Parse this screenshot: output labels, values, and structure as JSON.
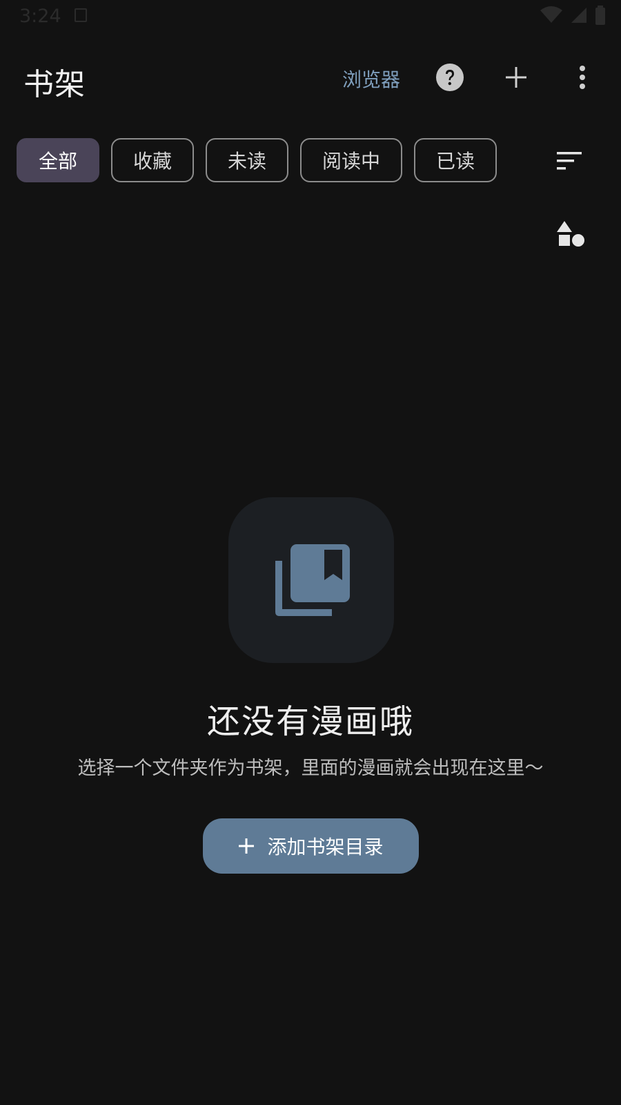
{
  "status_bar": {
    "time": "3:24"
  },
  "app_bar": {
    "title": "书架",
    "browser_label": "浏览器"
  },
  "filters": {
    "chips": [
      {
        "label": "全部",
        "selected": true
      },
      {
        "label": "收藏",
        "selected": false
      },
      {
        "label": "未读",
        "selected": false
      },
      {
        "label": "阅读中",
        "selected": false
      },
      {
        "label": "已读",
        "selected": false
      }
    ]
  },
  "empty_state": {
    "title": "还没有漫画哦",
    "subtitle": "选择一个文件夹作为书架，里面的漫画就会出现在这里～",
    "button_label": "添加书架目录"
  },
  "colors": {
    "background": "#121212",
    "accent": "#7f9fbd",
    "chip_selected": "#4a4458",
    "button": "#5f7b96",
    "empty_card": "#1c1f23"
  },
  "icons": {
    "help": "help-circle-icon",
    "add": "plus-icon",
    "more": "more-vertical-icon",
    "sort": "sort-icon",
    "shapes": "shapes-icon",
    "library": "library-bookmark-icon"
  }
}
